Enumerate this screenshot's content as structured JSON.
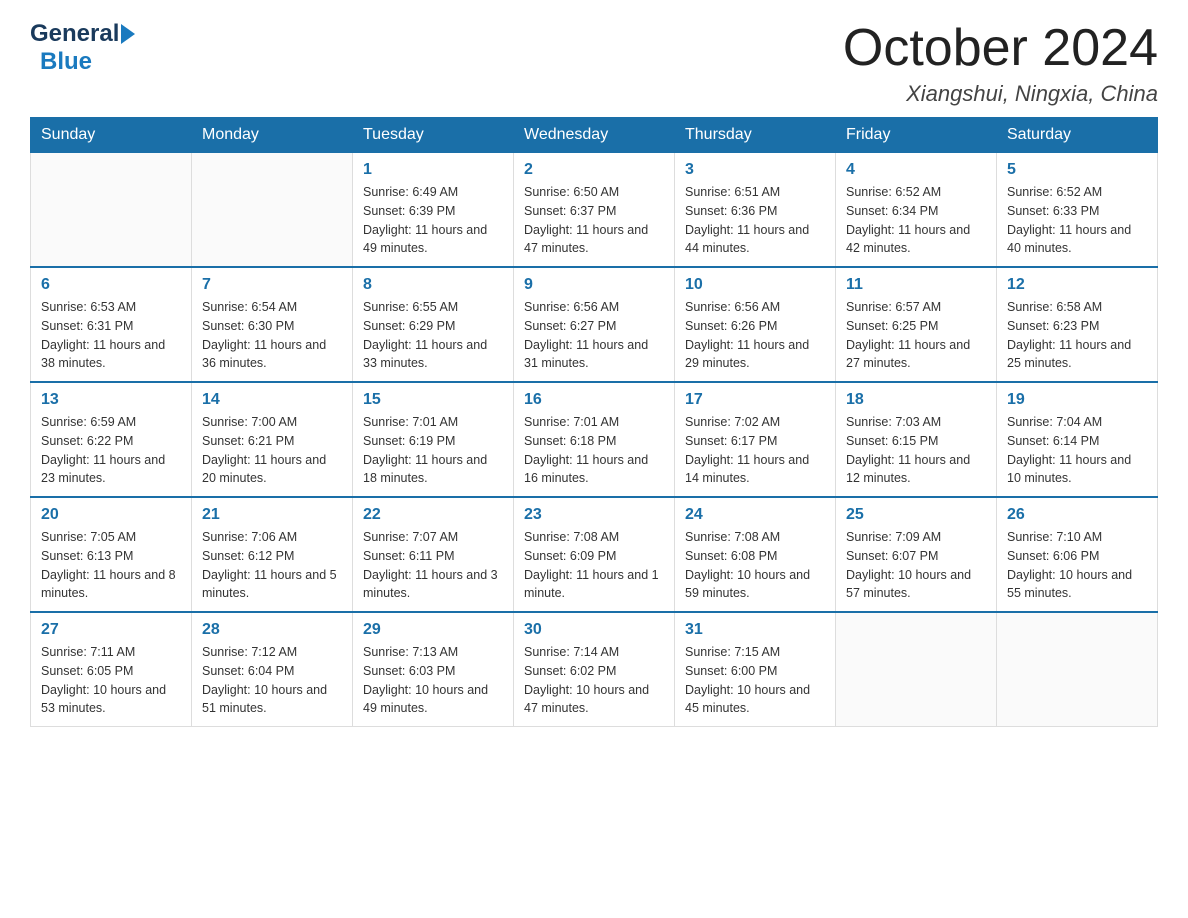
{
  "header": {
    "logo_general": "General",
    "logo_blue": "Blue",
    "month_title": "October 2024",
    "location": "Xiangshui, Ningxia, China"
  },
  "days_of_week": [
    "Sunday",
    "Monday",
    "Tuesday",
    "Wednesday",
    "Thursday",
    "Friday",
    "Saturday"
  ],
  "weeks": [
    [
      {
        "day": "",
        "sunrise": "",
        "sunset": "",
        "daylight": ""
      },
      {
        "day": "",
        "sunrise": "",
        "sunset": "",
        "daylight": ""
      },
      {
        "day": "1",
        "sunrise": "Sunrise: 6:49 AM",
        "sunset": "Sunset: 6:39 PM",
        "daylight": "Daylight: 11 hours and 49 minutes."
      },
      {
        "day": "2",
        "sunrise": "Sunrise: 6:50 AM",
        "sunset": "Sunset: 6:37 PM",
        "daylight": "Daylight: 11 hours and 47 minutes."
      },
      {
        "day": "3",
        "sunrise": "Sunrise: 6:51 AM",
        "sunset": "Sunset: 6:36 PM",
        "daylight": "Daylight: 11 hours and 44 minutes."
      },
      {
        "day": "4",
        "sunrise": "Sunrise: 6:52 AM",
        "sunset": "Sunset: 6:34 PM",
        "daylight": "Daylight: 11 hours and 42 minutes."
      },
      {
        "day": "5",
        "sunrise": "Sunrise: 6:52 AM",
        "sunset": "Sunset: 6:33 PM",
        "daylight": "Daylight: 11 hours and 40 minutes."
      }
    ],
    [
      {
        "day": "6",
        "sunrise": "Sunrise: 6:53 AM",
        "sunset": "Sunset: 6:31 PM",
        "daylight": "Daylight: 11 hours and 38 minutes."
      },
      {
        "day": "7",
        "sunrise": "Sunrise: 6:54 AM",
        "sunset": "Sunset: 6:30 PM",
        "daylight": "Daylight: 11 hours and 36 minutes."
      },
      {
        "day": "8",
        "sunrise": "Sunrise: 6:55 AM",
        "sunset": "Sunset: 6:29 PM",
        "daylight": "Daylight: 11 hours and 33 minutes."
      },
      {
        "day": "9",
        "sunrise": "Sunrise: 6:56 AM",
        "sunset": "Sunset: 6:27 PM",
        "daylight": "Daylight: 11 hours and 31 minutes."
      },
      {
        "day": "10",
        "sunrise": "Sunrise: 6:56 AM",
        "sunset": "Sunset: 6:26 PM",
        "daylight": "Daylight: 11 hours and 29 minutes."
      },
      {
        "day": "11",
        "sunrise": "Sunrise: 6:57 AM",
        "sunset": "Sunset: 6:25 PM",
        "daylight": "Daylight: 11 hours and 27 minutes."
      },
      {
        "day": "12",
        "sunrise": "Sunrise: 6:58 AM",
        "sunset": "Sunset: 6:23 PM",
        "daylight": "Daylight: 11 hours and 25 minutes."
      }
    ],
    [
      {
        "day": "13",
        "sunrise": "Sunrise: 6:59 AM",
        "sunset": "Sunset: 6:22 PM",
        "daylight": "Daylight: 11 hours and 23 minutes."
      },
      {
        "day": "14",
        "sunrise": "Sunrise: 7:00 AM",
        "sunset": "Sunset: 6:21 PM",
        "daylight": "Daylight: 11 hours and 20 minutes."
      },
      {
        "day": "15",
        "sunrise": "Sunrise: 7:01 AM",
        "sunset": "Sunset: 6:19 PM",
        "daylight": "Daylight: 11 hours and 18 minutes."
      },
      {
        "day": "16",
        "sunrise": "Sunrise: 7:01 AM",
        "sunset": "Sunset: 6:18 PM",
        "daylight": "Daylight: 11 hours and 16 minutes."
      },
      {
        "day": "17",
        "sunrise": "Sunrise: 7:02 AM",
        "sunset": "Sunset: 6:17 PM",
        "daylight": "Daylight: 11 hours and 14 minutes."
      },
      {
        "day": "18",
        "sunrise": "Sunrise: 7:03 AM",
        "sunset": "Sunset: 6:15 PM",
        "daylight": "Daylight: 11 hours and 12 minutes."
      },
      {
        "day": "19",
        "sunrise": "Sunrise: 7:04 AM",
        "sunset": "Sunset: 6:14 PM",
        "daylight": "Daylight: 11 hours and 10 minutes."
      }
    ],
    [
      {
        "day": "20",
        "sunrise": "Sunrise: 7:05 AM",
        "sunset": "Sunset: 6:13 PM",
        "daylight": "Daylight: 11 hours and 8 minutes."
      },
      {
        "day": "21",
        "sunrise": "Sunrise: 7:06 AM",
        "sunset": "Sunset: 6:12 PM",
        "daylight": "Daylight: 11 hours and 5 minutes."
      },
      {
        "day": "22",
        "sunrise": "Sunrise: 7:07 AM",
        "sunset": "Sunset: 6:11 PM",
        "daylight": "Daylight: 11 hours and 3 minutes."
      },
      {
        "day": "23",
        "sunrise": "Sunrise: 7:08 AM",
        "sunset": "Sunset: 6:09 PM",
        "daylight": "Daylight: 11 hours and 1 minute."
      },
      {
        "day": "24",
        "sunrise": "Sunrise: 7:08 AM",
        "sunset": "Sunset: 6:08 PM",
        "daylight": "Daylight: 10 hours and 59 minutes."
      },
      {
        "day": "25",
        "sunrise": "Sunrise: 7:09 AM",
        "sunset": "Sunset: 6:07 PM",
        "daylight": "Daylight: 10 hours and 57 minutes."
      },
      {
        "day": "26",
        "sunrise": "Sunrise: 7:10 AM",
        "sunset": "Sunset: 6:06 PM",
        "daylight": "Daylight: 10 hours and 55 minutes."
      }
    ],
    [
      {
        "day": "27",
        "sunrise": "Sunrise: 7:11 AM",
        "sunset": "Sunset: 6:05 PM",
        "daylight": "Daylight: 10 hours and 53 minutes."
      },
      {
        "day": "28",
        "sunrise": "Sunrise: 7:12 AM",
        "sunset": "Sunset: 6:04 PM",
        "daylight": "Daylight: 10 hours and 51 minutes."
      },
      {
        "day": "29",
        "sunrise": "Sunrise: 7:13 AM",
        "sunset": "Sunset: 6:03 PM",
        "daylight": "Daylight: 10 hours and 49 minutes."
      },
      {
        "day": "30",
        "sunrise": "Sunrise: 7:14 AM",
        "sunset": "Sunset: 6:02 PM",
        "daylight": "Daylight: 10 hours and 47 minutes."
      },
      {
        "day": "31",
        "sunrise": "Sunrise: 7:15 AM",
        "sunset": "Sunset: 6:00 PM",
        "daylight": "Daylight: 10 hours and 45 minutes."
      },
      {
        "day": "",
        "sunrise": "",
        "sunset": "",
        "daylight": ""
      },
      {
        "day": "",
        "sunrise": "",
        "sunset": "",
        "daylight": ""
      }
    ]
  ]
}
